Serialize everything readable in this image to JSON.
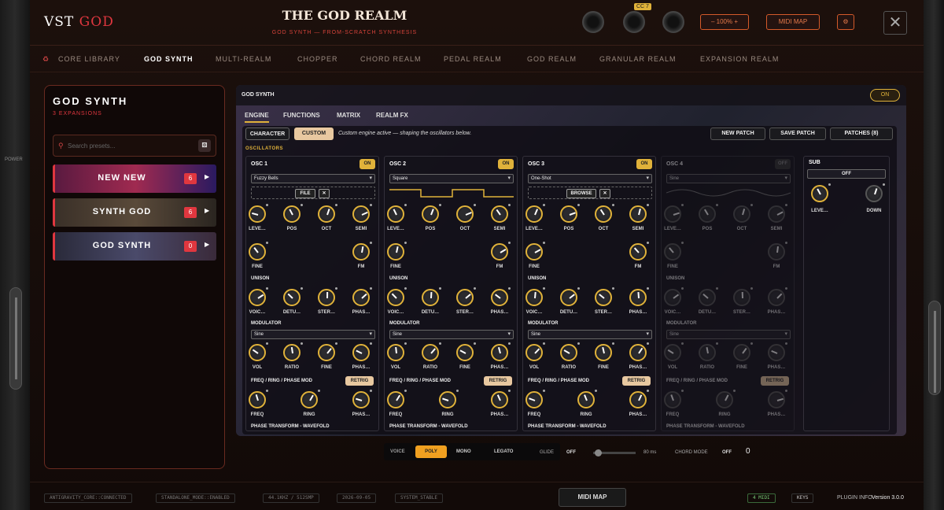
{
  "app": {
    "logo_a": "VST",
    "logo_b": "GOD",
    "title": "THE GOD REALM",
    "subtitle": "GOD SYNTH — FROM-SCRATCH SYNTHESIS",
    "cc": "CC 7",
    "zoom": "–  100%  +",
    "midi_map": "MIDI MAP",
    "power": "POWER"
  },
  "nav": [
    "CORE LIBRARY",
    "GOD SYNTH",
    "MULTI-REALM",
    "CHOPPER",
    "CHORD REALM",
    "PEDAL REALM",
    "GOD REALM",
    "GRANULAR REALM",
    "EXPANSION REALM"
  ],
  "sidebar": {
    "title": "GOD SYNTH",
    "expansions": "3 EXPANSIONS",
    "search_placeholder": "Search presets...",
    "items": [
      {
        "name": "NEW NEW",
        "count": "6"
      },
      {
        "name": "SYNTH GOD",
        "count": "6"
      },
      {
        "name": "GOD SYNTH",
        "count": "0"
      }
    ]
  },
  "main": {
    "header": "GOD SYNTH",
    "on": "ON",
    "tabs": [
      "ENGINE",
      "FUNCTIONS",
      "MATRIX",
      "REALM FX"
    ],
    "character": "CHARACTER",
    "custom": "CUSTOM",
    "desc": "Custom engine active — shaping the oscillators below.",
    "new_patch": "NEW PATCH",
    "save_patch": "SAVE PATCH",
    "patches": "PATCHES (8)",
    "osc_label": "OSCILLATORS"
  },
  "osc": [
    {
      "name": "OSC 1",
      "state": "ON",
      "wave": "Fuzzy Bells",
      "file": "FILE",
      "x": "✕"
    },
    {
      "name": "OSC 2",
      "state": "ON",
      "wave": "Square"
    },
    {
      "name": "OSC 3",
      "state": "ON",
      "wave": "One-Shot",
      "file": "BROWSE",
      "x": "✕"
    },
    {
      "name": "OSC 4",
      "state": "OFF",
      "wave": "Sine"
    }
  ],
  "labels": {
    "row1": [
      "LEVE…",
      "POS",
      "OCT",
      "SEMI"
    ],
    "row2": [
      "FINE",
      "FM"
    ],
    "unison": "UNISON",
    "row3": [
      "VOIC…",
      "DETU…",
      "STER…",
      "PHAS…"
    ],
    "modulator": "MODULATOR",
    "mod_wave": "Sine",
    "row4": [
      "VOL",
      "RATIO",
      "FINE",
      "PHAS…"
    ],
    "freq": "FREQ / RING / PHASE MOD",
    "retrig": "RETRIG",
    "row5": [
      "FREQ",
      "RING",
      "PHAS…"
    ],
    "phase": "PHASE TRANSFORM - WAVEFOLD"
  },
  "sub": {
    "title": "SUB",
    "state": "OFF",
    "k1": "LEVE…",
    "k2": "DOWN"
  },
  "bottom": {
    "voice": "VOICE",
    "poly": "POLY",
    "mono": "MONO",
    "legato": "LEGATO",
    "glide": "GLIDE",
    "glide_state": "OFF",
    "glide_ms": "80 ms",
    "chord": "CHORD MODE",
    "chord_state": "OFF",
    "chord_val": "0"
  },
  "status": {
    "s1": "ANTIGRAVITY_CORE::CONNECTED",
    "s2": "STANDALONE_MODE::ENABLED",
    "s3": "44.1KHZ / 512SMP",
    "s4": "2026-09-05",
    "s5": "SYSTEM_STABLE",
    "midi": "MIDI MAP",
    "midi_count": "4 MIDI",
    "keys": "KEYS",
    "info": "PLUGIN INFO",
    "version": "Version 3.0.0"
  }
}
